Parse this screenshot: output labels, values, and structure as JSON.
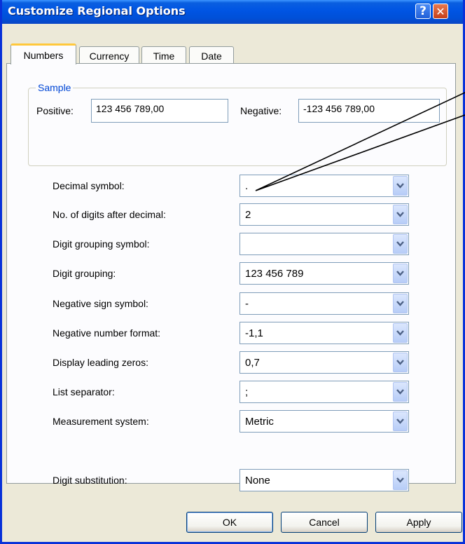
{
  "window": {
    "title": "Customize Regional Options",
    "help_glyph": "?",
    "close_glyph": "✕"
  },
  "tabs": [
    {
      "label": "Numbers",
      "active": true
    },
    {
      "label": "Currency",
      "active": false
    },
    {
      "label": "Time",
      "active": false
    },
    {
      "label": "Date",
      "active": false
    }
  ],
  "sample": {
    "legend": "Sample",
    "positive_label": "Positive:",
    "positive_value": "123 456 789,00",
    "negative_label": "Negative:",
    "negative_value": "-123 456 789,00"
  },
  "settings": [
    {
      "label": "Decimal symbol:",
      "value": "."
    },
    {
      "label": "No. of digits after decimal:",
      "value": "2"
    },
    {
      "label": "Digit grouping symbol:",
      "value": ""
    },
    {
      "label": "Digit grouping:",
      "value": "123 456 789"
    },
    {
      "label": "Negative sign symbol:",
      "value": "-"
    },
    {
      "label": "Negative number format:",
      "value": "-1,1"
    },
    {
      "label": "Display leading zeros:",
      "value": "0,7"
    },
    {
      "label": "List separator:",
      "value": ";"
    },
    {
      "label": "Measurement system:",
      "value": "Metric"
    },
    {
      "label": "Digit substitution:",
      "value": "None"
    }
  ],
  "buttons": {
    "ok": "OK",
    "cancel": "Cancel",
    "apply": "Apply"
  },
  "icons": {
    "dropdown": "chevron-down-icon",
    "help": "help-icon",
    "close": "close-icon"
  },
  "colors": {
    "titlebar": "#0054e3",
    "dialog_bg": "#ece9d8",
    "accent_tab": "#ffc83c",
    "group_legend": "#0046d5"
  }
}
